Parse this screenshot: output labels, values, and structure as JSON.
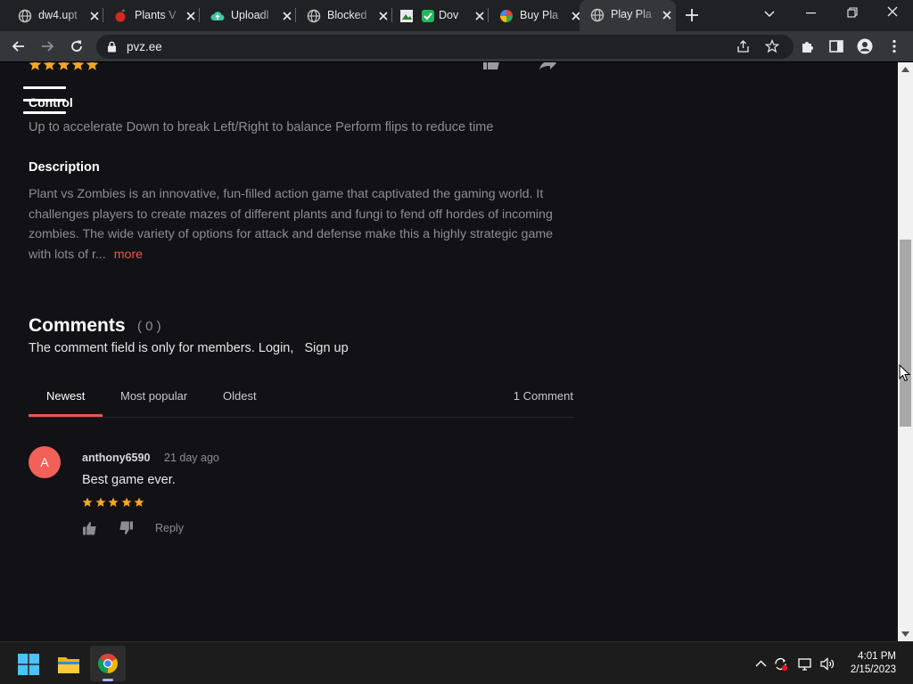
{
  "browser": {
    "tabs": [
      {
        "title": "dw4.upt",
        "icon": "globe-icon"
      },
      {
        "title": "Plants V",
        "icon": "pvz-favicon"
      },
      {
        "title": "Uploadl",
        "icon": "upload-cloud-icon"
      },
      {
        "title": "Blocked",
        "icon": "globe-icon"
      },
      {
        "title": "Dov",
        "icon": "download-favicon"
      },
      {
        "title": "Buy Pla",
        "icon": "store-favicon"
      },
      {
        "title": "Play Pla",
        "icon": "globe-icon",
        "active": true
      }
    ],
    "url": "pvz.ee"
  },
  "page": {
    "control_heading": "Control",
    "controls_text": "Up to accelerate Down to break Left/Right to balance Perform flips to reduce time",
    "description_heading": "Description",
    "description_text": "Plant vs Zombies is an innovative, fun-filled action game that captivated the gaming world. It challenges players to create mazes of different plants and fungi to fend off hordes of incoming zombies. The wide variety of options for attack and defense make this a highly strategic game with lots of r...",
    "more_label": "more"
  },
  "comments": {
    "heading": "Comments",
    "count": "( 0 )",
    "member_note": "The comment field is only for members.",
    "login_label": "Login,",
    "signup_label": "Sign up",
    "sort_tabs": [
      "Newest",
      "Most popular",
      "Oldest"
    ],
    "active_sort": "Newest",
    "total_label": "1 Comment",
    "items": [
      {
        "avatar_letter": "A",
        "author": "anthony6590",
        "ago": "21 day ago",
        "text": "Best game ever.",
        "rating": 5,
        "reply_label": "Reply"
      }
    ]
  },
  "colors": {
    "accent": "#f0564a",
    "star": "#f5a623",
    "page_bg": "#121216"
  },
  "taskbar": {
    "time": "4:01 PM",
    "date": "2/15/2023"
  }
}
